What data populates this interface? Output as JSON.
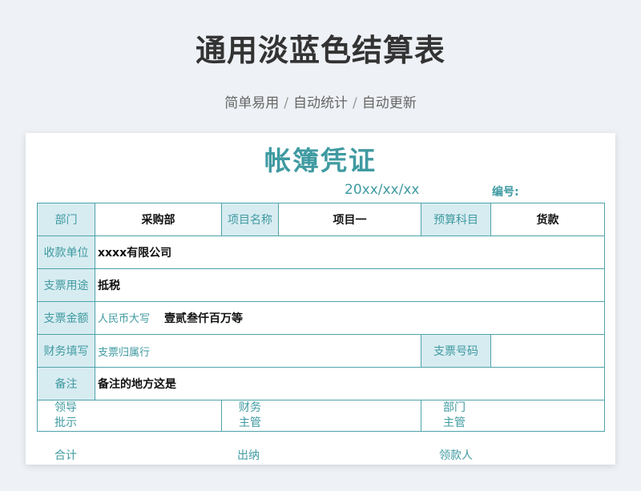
{
  "header": {
    "title": "通用淡蓝色结算表",
    "subtitle_parts": [
      "简单易用",
      "自动统计",
      "自动更新"
    ],
    "separator": "/"
  },
  "voucher": {
    "title": "帐簿凭证",
    "date": "20xx/xx/xx",
    "number_label": "编号:",
    "row1": {
      "dept_label": "部门",
      "dept_value": "采购部",
      "project_label": "项目名称",
      "project_value": "项目一",
      "budget_label": "预算科目",
      "budget_value": "货款"
    },
    "payee": {
      "label": "收款单位",
      "value": "xxxx有限公司"
    },
    "purpose": {
      "label": "支票用途",
      "value": "抵税"
    },
    "amount": {
      "label": "支票金额",
      "hint": "人民币大写",
      "value": "壹贰叁仟百万等"
    },
    "finance": {
      "label": "财务填写",
      "hint": "支票归属行",
      "check_no_label": "支票号码"
    },
    "remark": {
      "label": "备注",
      "value": "备注的地方这是"
    },
    "sign": {
      "leader": [
        "领导",
        "批示"
      ],
      "finance": [
        "财务",
        "主管"
      ],
      "dept": [
        "部门",
        "主管"
      ]
    },
    "footer": {
      "total": "合计",
      "cashier": "出纳",
      "receiver": "领款人"
    }
  }
}
